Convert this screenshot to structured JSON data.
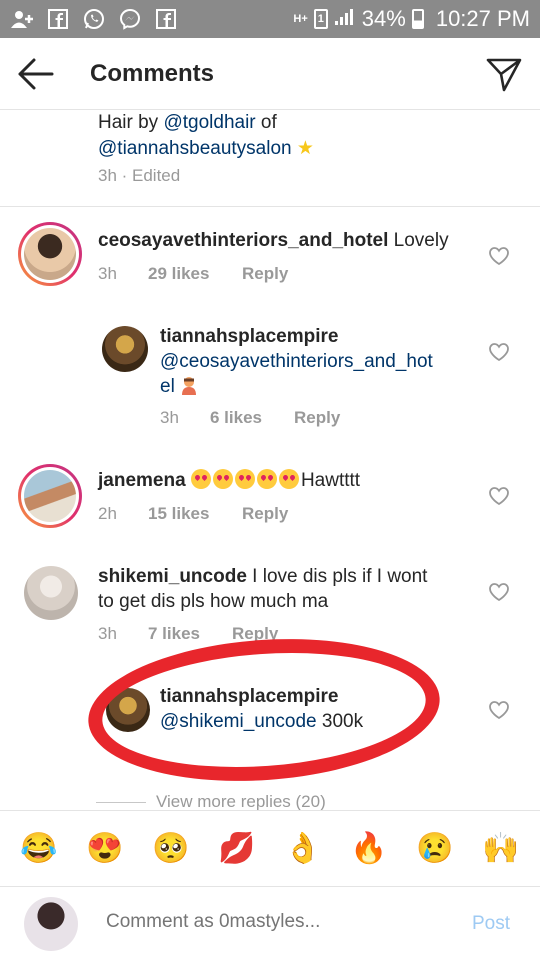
{
  "status_bar": {
    "network": "H+",
    "sim": "1",
    "battery": "34%",
    "time": "10:27 PM"
  },
  "header": {
    "title": "Comments"
  },
  "caption": {
    "prefix": "Hair by ",
    "mention1": "@tgoldhair",
    "mid": " of",
    "mention2": "@tiannahsbeautysalon",
    "star": "★",
    "meta": "3h · Edited"
  },
  "comments": [
    {
      "username": "ceosayavethinteriors_and_hotel",
      "text": " Lovely",
      "time": "3h",
      "likes": "29 likes",
      "reply": "Reply"
    },
    {
      "username": "tiannahsplacempire",
      "text_line1": "@ceosayavethinteriors_and_hot",
      "text_line2": "el",
      "time": "3h",
      "likes": "6 likes",
      "reply": "Reply"
    },
    {
      "username": "janemena",
      "text": "Hawtttt",
      "time": "2h",
      "likes": "15 likes",
      "reply": "Reply"
    },
    {
      "username": "shikemi_uncode",
      "text_line1": " I love dis pls if I wont",
      "text_line2": "to get dis pls how much ma",
      "time": "3h",
      "likes": "7 likes",
      "reply": "Reply"
    },
    {
      "username": "tiannahsplacempire",
      "text_line1": "@shikemi_uncode",
      "text_line1b": " 300k"
    }
  ],
  "view_more": "View more replies (20)",
  "emoji_bar": [
    "😂",
    "😍",
    "🥺",
    "💋",
    "👌",
    "🔥",
    "😢",
    "🙌"
  ],
  "input": {
    "placeholder": "Comment as 0mastyles...",
    "post": "Post"
  },
  "colors": {
    "accent_link": "#003569",
    "post_disabled": "#9ecaf3",
    "annotation_red": "#e8262c",
    "status_bar": "#8a8a8a"
  }
}
